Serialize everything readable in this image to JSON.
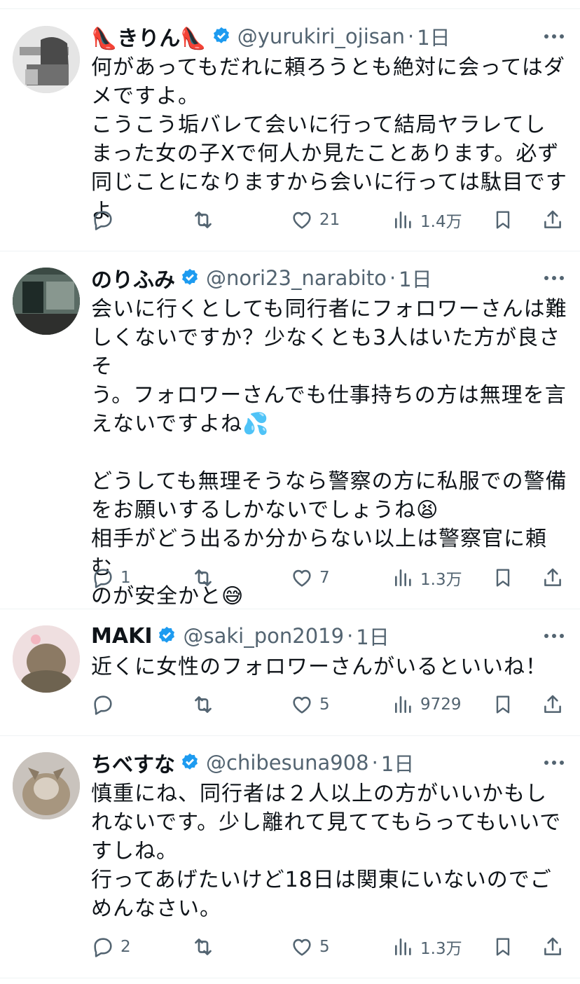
{
  "tweets": [
    {
      "name": "👠きりん👠",
      "handle": "@yurukiri_ojisan",
      "time": "1日",
      "text": "何があってもだれに頼ろうとも絶対に会ってはダメですよ。\nこうこう垢バレて会いに行って結局ヤラレてしまった女の子Xで何人か見たことあります。必ず同じことになりますから会いに行っては駄目ですよ",
      "replies": "",
      "likes": "21",
      "views": "1.4万",
      "icons": [
        "reply-icon",
        "retweet-icon",
        "like-icon",
        "views-icon",
        "bookmark-icon",
        "share-icon",
        "verified-icon",
        "more-icon"
      ]
    },
    {
      "name": "のりふみ",
      "handle": "@nori23_narabito",
      "time": "1日",
      "text_lines": [
        "会いに行くとしても同行者にフォロワーさんは難",
        "しくないですか？少なくとも3人はいた方が良さそ",
        "う。フォロワーさんでも仕事持ちの方は無理を言",
        "えないですよね💦",
        "",
        "どうしても無理そうなら警察の方に私服での警備",
        "をお願いするしかないでしょうね😫",
        "相手がどう出るか分からない以上は警察官に頼む",
        "のが安全かと😅"
      ],
      "replies": "1",
      "likes": "7",
      "views": "1.3万"
    },
    {
      "name": "MAKI",
      "handle": "@saki_pon2019",
      "time": "1日",
      "text": "近くに女性のフォロワーさんがいるといいね！",
      "replies": "",
      "likes": "5",
      "views": "9729"
    },
    {
      "name": "ちべすな",
      "handle": "@chibesuna908",
      "time": "1日",
      "text": "慎重にね、同行者は２人以上の方がいいかもしれないです。少し離れて見ててもらってもいいですしね。\n行ってあげたいけど18日は関東にいないのでごめんなさい。",
      "replies": "2",
      "likes": "5",
      "views": "1.3万"
    }
  ],
  "colors": {
    "text": "#0f1419",
    "muted": "#536471",
    "verified": "#1d9bf0",
    "divider": "#eff3f4"
  }
}
